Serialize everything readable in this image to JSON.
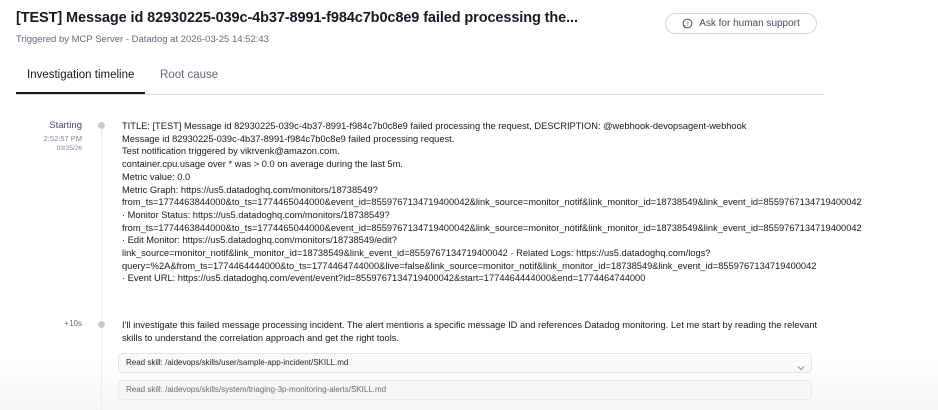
{
  "header": {
    "title": "[TEST] Message id 82930225-039c-4b37-8991-f984c7b0c8e9 failed processing the...",
    "subtitle": "Triggered by MCP Server - Datadog at 2026-03-25 14:52:43",
    "support_button": "Ask for human support",
    "support_icon": "chat-bubble-icon"
  },
  "tabs": [
    {
      "label": "Investigation timeline",
      "active": true
    },
    {
      "label": "Root cause",
      "active": false
    }
  ],
  "timeline": {
    "entries": [
      {
        "label": "Starting",
        "time": "2:52:57 PM",
        "date": "03/25/26",
        "lines": [
          "TITLE: [TEST] Message id 82930225-039c-4b37-8991-f984c7b0c8e9 failed processing the request, DESCRIPTION: @webhook-devopsagent-webhook",
          "Message id 82930225-039c-4b37-8991-f984c7b0c8e9 failed processing request.",
          "Test notification triggered by vikrvenk@amazon.com.",
          "container.cpu.usage over * was > 0.0 on average during the last 5m.",
          "Metric value: 0.0",
          "Metric Graph: https://us5.datadoghq.com/monitors/18738549?",
          "from_ts=1774463844000&to_ts=1774465044000&event_id=8559767134719400042&link_source=monitor_notif&link_monitor_id=18738549&link_event_id=8559767134719400042",
          "· Monitor Status: https://us5.datadoghq.com/monitors/18738549?",
          "from_ts=1774463844000&to_ts=1774465044000&event_id=8559767134719400042&link_source=monitor_notif&link_monitor_id=18738549&link_event_id=8559767134719400042",
          "· Edit Monitor: https://us5.datadoghq.com/monitors/18738549/edit?",
          "link_source=monitor_notif&link_monitor_id=18738549&link_event_id=8559767134719400042 · Related Logs: https://us5.datadoghq.com/logs?",
          "query=%2A&from_ts=1774464444000&to_ts=1774464744000&live=false&link_source=monitor_notif&link_monitor_id=18738549&link_event_id=8559767134719400042",
          "· Event URL: https://us5.datadoghq.com/event/event?id=8559767134719400042&start=1774464444000&end=1774464744000"
        ]
      },
      {
        "label": "+10s",
        "text": "I'll investigate this failed message processing incident. The alert mentions a specific message ID and references Datadog monitoring. Let me start by reading the relevant skills to understand the correlation approach and get the right tools.",
        "skills": [
          {
            "label": "Read skill: /aidevops/skills/user/sample-app-incident/SKILL.md",
            "icon": "chevron-down-icon"
          },
          {
            "label": "Read skill: /aidevops/skills/system/triaging-3p-monitoring-alerts/SKILL.md"
          }
        ]
      }
    ]
  }
}
